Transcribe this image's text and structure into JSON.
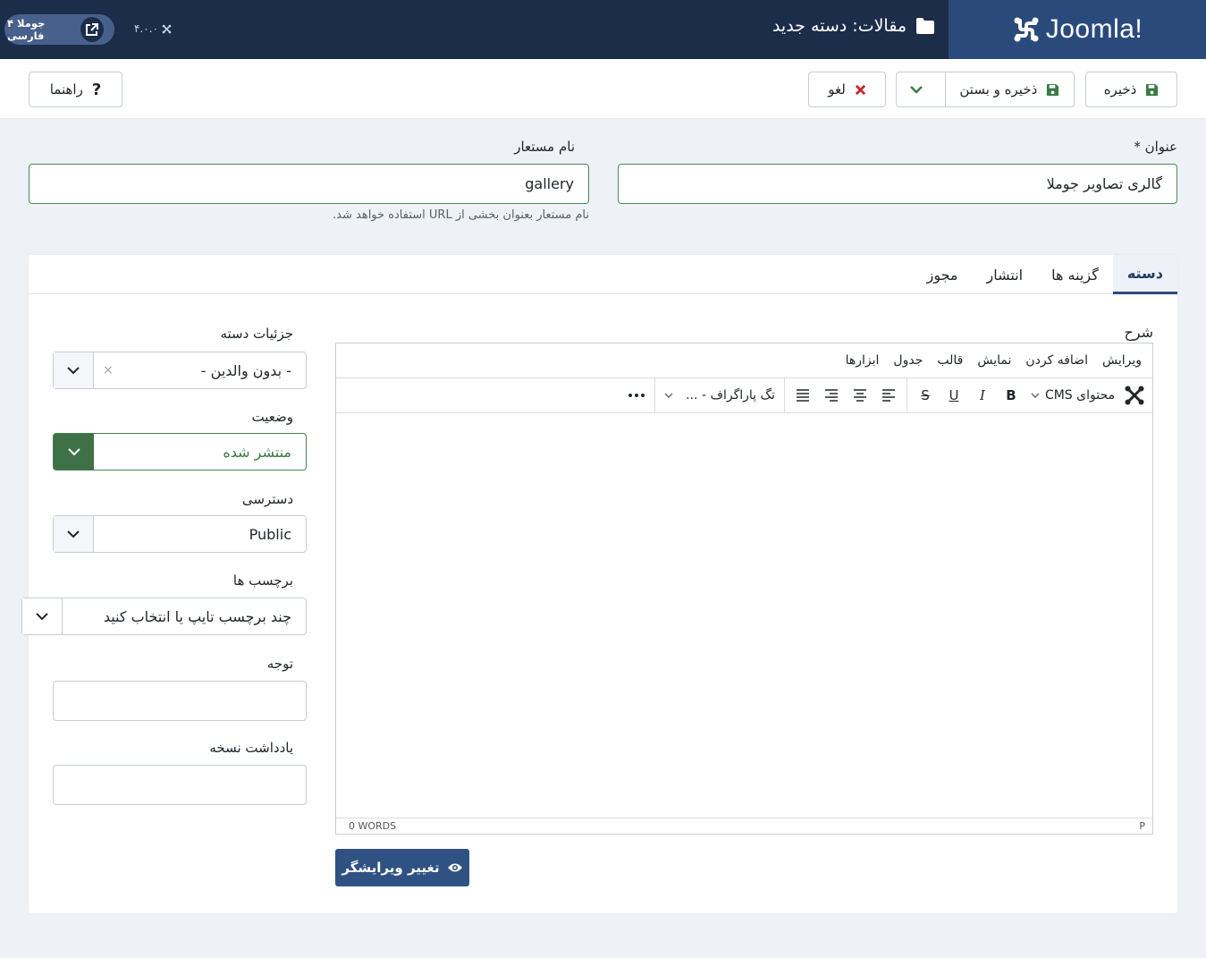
{
  "header": {
    "brand": "Joomla!",
    "page_title": "مقالات: دسته جدید",
    "site_link_label": "جوملا ۴ فارسی",
    "version": "۴.۰.۰"
  },
  "toolbar": {
    "save_label": "ذخیره",
    "save_close_label": "ذخیره و بستن",
    "cancel_label": "لغو",
    "help_label": "راهنما"
  },
  "form": {
    "title_label": "عنوان *",
    "title_value": "گالری تصاویر جوملا",
    "alias_label": "نام مستعار",
    "alias_value": "gallery",
    "alias_hint": "نام مستعار بعنوان بخشی از URL استفاده خواهد شد."
  },
  "tabs": [
    {
      "label": "دسته",
      "active": true
    },
    {
      "label": "گزینه ها",
      "active": false
    },
    {
      "label": "انتشار",
      "active": false
    },
    {
      "label": "مجوز",
      "active": false
    }
  ],
  "editor": {
    "label": "شرح",
    "menu": [
      "ویرایش",
      "اضافه کردن",
      "نمایش",
      "قالب",
      "جدول",
      "ابزارها"
    ],
    "cms_content": "محتوای CMS",
    "paragraph": "تگ پاراگراف - ...",
    "status_path": "P",
    "word_count": "0 WORDS",
    "toggle_label": "تغییر ویرایشگر"
  },
  "sidebar": {
    "parent_label": "جزئیات دسته",
    "parent_value": "- بدون والدین -",
    "state_label": "وضعیت",
    "state_value": "منتشر شده",
    "access_label": "دسترسی",
    "access_value": "Public",
    "tags_label": "برچسب ها",
    "tags_placeholder": "چند برچسب تایپ یا انتخاب کنید",
    "note_label": "توجه",
    "version_note_label": "یادداشت نسخه"
  },
  "colors": {
    "header_bg": "#1c2d4a",
    "logo_bg": "#2a4a7b",
    "save_icon": "#3b7a44",
    "cancel_icon": "#c52827",
    "state_green": "#3f7147"
  }
}
